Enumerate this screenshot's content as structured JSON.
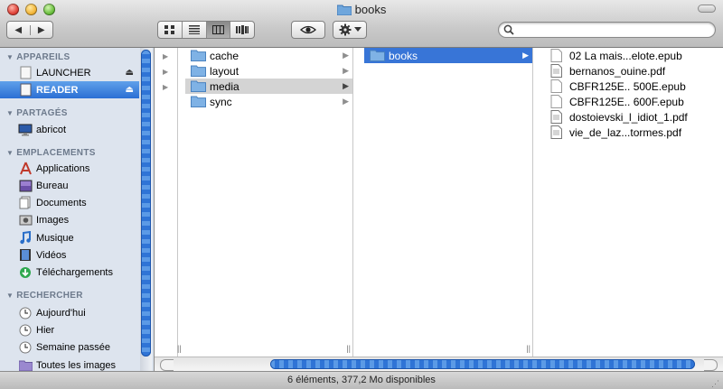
{
  "window": {
    "title": "books"
  },
  "toolbar": {
    "back_label": "◀",
    "forward_label": "▶",
    "search_placeholder": ""
  },
  "sidebar": {
    "sections": [
      {
        "label": "APPAREILS"
      },
      {
        "label": "PARTAGÉS"
      },
      {
        "label": "EMPLACEMENTS"
      },
      {
        "label": "RECHERCHER"
      }
    ],
    "devices": [
      {
        "label": "LAUNCHER",
        "icon": "drive-icon"
      },
      {
        "label": "READER",
        "icon": "drive-icon",
        "selected": true
      }
    ],
    "shared": [
      {
        "label": "abricot",
        "icon": "computer-icon"
      }
    ],
    "places": [
      {
        "label": "Applications",
        "icon": "applications-icon"
      },
      {
        "label": "Bureau",
        "icon": "desktop-icon"
      },
      {
        "label": "Documents",
        "icon": "documents-icon"
      },
      {
        "label": "Images",
        "icon": "images-icon"
      },
      {
        "label": "Musique",
        "icon": "music-icon"
      },
      {
        "label": "Vidéos",
        "icon": "videos-icon"
      },
      {
        "label": "Téléchargements",
        "icon": "downloads-icon"
      }
    ],
    "search": [
      {
        "label": "Aujourd'hui",
        "icon": "clock-icon"
      },
      {
        "label": "Hier",
        "icon": "clock-icon"
      },
      {
        "label": "Semaine passée",
        "icon": "clock-icon"
      },
      {
        "label": "Toutes les images",
        "icon": "smart-folder-icon"
      }
    ]
  },
  "columns": {
    "col1": [
      {
        "label": "cache"
      },
      {
        "label": "layout"
      },
      {
        "label": "media",
        "state": "gray"
      },
      {
        "label": "sync"
      }
    ],
    "col2": [
      {
        "label": "books",
        "state": "selected"
      }
    ],
    "col3": [
      {
        "label": "02 La mais...elote.epub"
      },
      {
        "label": "bernanos_ouine.pdf"
      },
      {
        "label": "CBFR125E.. 500E.epub"
      },
      {
        "label": "CBFR125E.. 600F.epub"
      },
      {
        "label": "dostoievski_l_idiot_1.pdf"
      },
      {
        "label": "vie_de_laz...tormes.pdf"
      }
    ]
  },
  "status": {
    "text": "6 éléments, 377,2 Mo disponibles"
  },
  "colors": {
    "selection": "#3875d7",
    "sidebar_bg": "#dde4ee",
    "sidebar_selected": "#2b6fd4"
  }
}
